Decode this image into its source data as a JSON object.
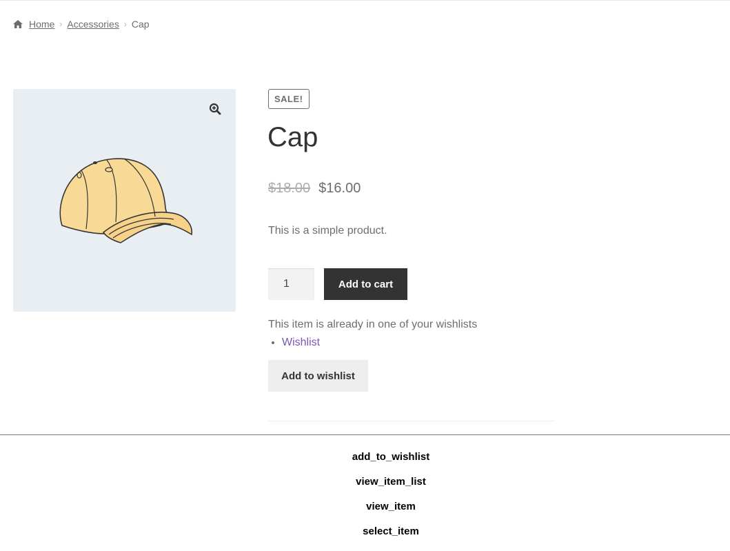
{
  "breadcrumb": {
    "home": "Home",
    "category": "Accessories",
    "current": "Cap"
  },
  "icons": {
    "home": "home-icon",
    "zoom": "zoom-in-icon",
    "separator": "chevron-right-icon"
  },
  "product": {
    "badge": "SALE!",
    "title": "Cap",
    "regular_price": "$18.00",
    "sale_price": "$16.00",
    "short_description": "This is a simple product.",
    "quantity": "1",
    "add_to_cart_label": "Add to cart"
  },
  "wishlist": {
    "note": "This item is already in one of your wishlists",
    "lists": [
      "Wishlist"
    ],
    "add_label": "Add to wishlist"
  },
  "events": [
    "add_to_wishlist",
    "view_item_list",
    "view_item",
    "select_item"
  ],
  "colors": {
    "primary_button": "#333333",
    "link": "#7f54b3",
    "gallery_bg": "#e9eef2",
    "secondary_button": "#eeeeee"
  }
}
